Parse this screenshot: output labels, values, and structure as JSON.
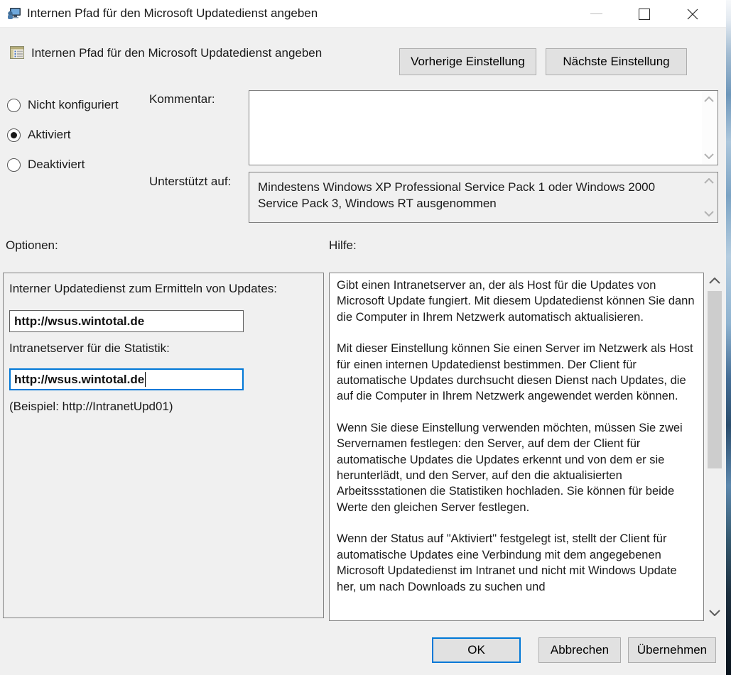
{
  "window": {
    "title": "Internen Pfad für den Microsoft Updatedienst angeben"
  },
  "header": {
    "title": "Internen Pfad für den Microsoft Updatedienst angeben",
    "prev_button": "Vorherige Einstellung",
    "next_button": "Nächste Einstellung"
  },
  "state": {
    "options": [
      {
        "label": "Nicht konfiguriert",
        "selected": false
      },
      {
        "label": "Aktiviert",
        "selected": true
      },
      {
        "label": "Deaktiviert",
        "selected": false
      }
    ],
    "comment_label": "Kommentar:",
    "comment_value": "",
    "supported_label": "Unterstützt auf:",
    "supported_value": "Mindestens Windows XP Professional Service Pack 1 oder Windows 2000 Service Pack 3, Windows RT ausgenommen"
  },
  "options_panel": {
    "heading": "Optionen:",
    "field1_label": "Interner Updatedienst zum Ermitteln von Updates:",
    "field1_value": "http://wsus.wintotal.de",
    "field2_label": "Intranetserver für die Statistik:",
    "field2_value": "http://wsus.wintotal.de",
    "example": "(Beispiel: http://IntranetUpd01)"
  },
  "help_panel": {
    "heading": "Hilfe:",
    "paragraphs": [
      "Gibt einen Intranetserver an, der als Host für die Updates von Microsoft Update fungiert. Mit diesem Updatedienst können Sie dann die Computer in Ihrem Netzwerk automatisch aktualisieren.",
      "Mit dieser Einstellung können Sie einen Server im Netzwerk als Host für einen internen Updatedienst bestimmen. Der Client für automatische Updates durchsucht diesen Dienst nach Updates, die auf die Computer in Ihrem Netzwerk angewendet werden können.",
      "Wenn Sie diese Einstellung verwenden möchten, müssen Sie zwei Servernamen festlegen: den Server, auf dem der Client für automatische Updates die Updates erkennt und von dem er sie herunterlädt, und den Server, auf den die aktualisierten Arbeitssstationen die Statistiken hochladen. Sie können für beide Werte den gleichen Server festlegen.",
      "Wenn der Status auf \"Aktiviert\" festgelegt ist, stellt der Client für automatische Updates eine Verbindung mit dem angegebenen Microsoft Updatedienst im Intranet und nicht mit Windows Update her, um nach Downloads zu suchen und"
    ]
  },
  "footer": {
    "ok": "OK",
    "cancel": "Abbrechen",
    "apply": "Übernehmen"
  },
  "colors": {
    "accent": "#0078d7",
    "dialog_bg": "#f0f0f0",
    "titlebar_bg": "#ffffff",
    "button_bg": "#e1e1e1",
    "button_border": "#adadad",
    "focus_border": "#0078d7"
  }
}
